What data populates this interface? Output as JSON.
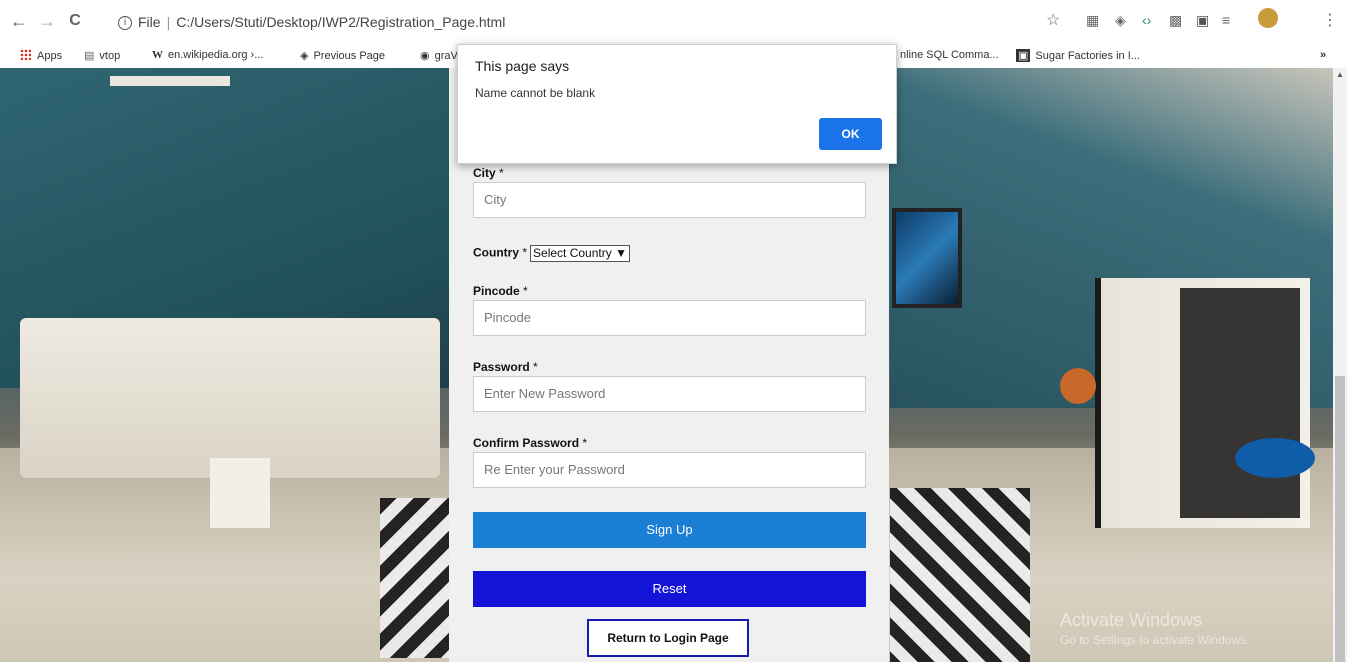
{
  "browser": {
    "back_glyph": "←",
    "forward_glyph": "→",
    "reload_glyph": "C",
    "info_glyph": "i",
    "file_label": "File",
    "separator": "|",
    "url": "C:/Users/Stuti/Desktop/IWP2/Registration_Page.html",
    "star_glyph": "☆",
    "menu_glyph": "⋮",
    "overflow_glyph": "»"
  },
  "bookmarks": [
    {
      "label": "Apps",
      "icon": "apps-grid-icon"
    },
    {
      "label": "vtop",
      "icon": "vtop-icon"
    },
    {
      "label": "en.wikipedia.org ›...",
      "icon": "wikipedia-icon"
    },
    {
      "label": "Previous Page",
      "icon": "diamond-icon"
    },
    {
      "label": "graV",
      "icon": "globe-icon"
    },
    {
      "label": "nline SQL Comma...",
      "icon": "none"
    },
    {
      "label": "Sugar Factories in I...",
      "icon": "sugar-icon"
    }
  ],
  "dialog": {
    "title": "This page says",
    "message": "Name cannot be blank",
    "ok_label": "OK"
  },
  "form": {
    "city": {
      "label": "City",
      "required": "*",
      "placeholder": "City"
    },
    "country": {
      "label": "Country",
      "required": "*",
      "select_value": "Select Country"
    },
    "pincode": {
      "label": "Pincode",
      "required": "*",
      "placeholder": "Pincode"
    },
    "password": {
      "label": "Password",
      "required": "*",
      "placeholder": "Enter New Password"
    },
    "confirm_password": {
      "label": "Confirm Password",
      "required": "*",
      "placeholder": "Re Enter your Password"
    },
    "signup_label": "Sign Up",
    "reset_label": "Reset",
    "return_label": "Return to Login Page"
  },
  "watermark": {
    "line1": "Activate Windows",
    "line2": "Go to Settings to activate Windows."
  },
  "colors": {
    "signup": "#1a7ed4",
    "reset": "#1414d8",
    "ok_button": "#1a73e8"
  }
}
